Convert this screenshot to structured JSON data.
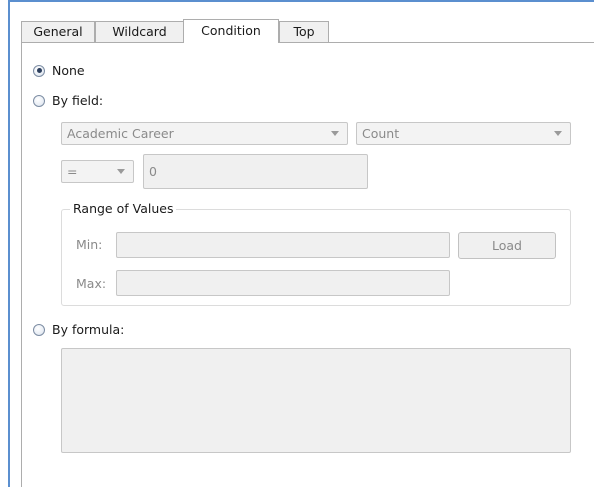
{
  "tabs": [
    {
      "label": "General",
      "active": false
    },
    {
      "label": "Wildcard",
      "active": false
    },
    {
      "label": "Condition",
      "active": true
    },
    {
      "label": "Top",
      "active": false
    }
  ],
  "condition": {
    "none_label": "None",
    "selected": "None",
    "by_field_label": "By field:",
    "field_select_value": "Academic Career",
    "aggregate_select_value": "Count",
    "operator_select_value": "=",
    "value_input": "0",
    "range": {
      "legend": "Range of Values",
      "min_label": "Min:",
      "min_value": "",
      "max_label": "Max:",
      "max_value": "",
      "load_label": "Load"
    },
    "by_formula_label": "By formula:",
    "formula_value": ""
  },
  "colors": {
    "accent_border": "#5b8fcf",
    "disabled_text": "#8a8a8a",
    "disabled_field_bg": "#f0f0f0"
  }
}
